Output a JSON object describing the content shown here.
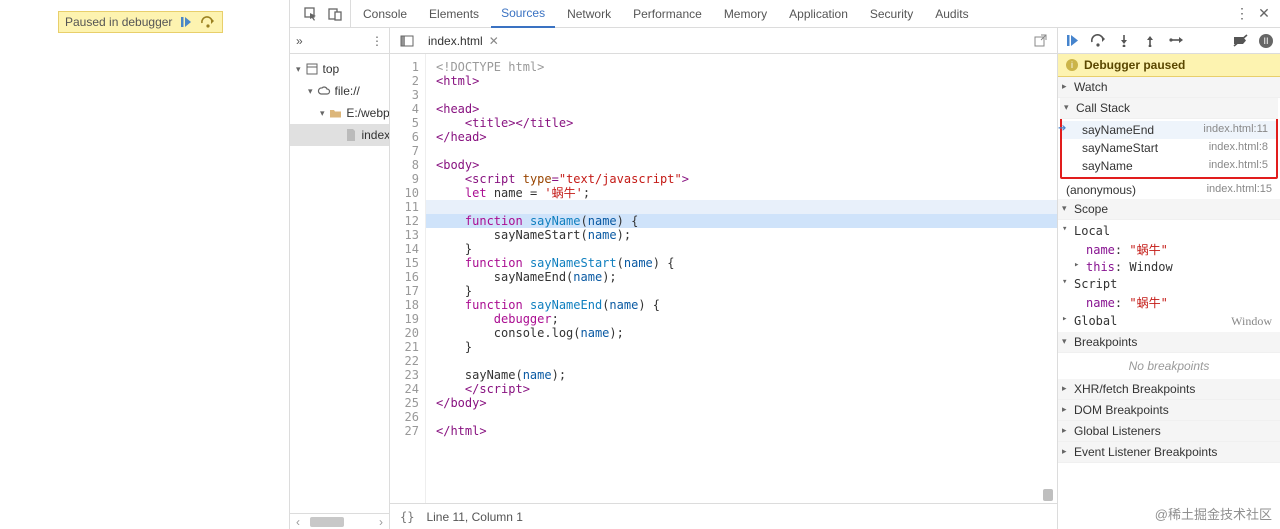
{
  "paused_overlay": {
    "label": "Paused in debugger"
  },
  "tabbar": {
    "tabs": [
      "Console",
      "Elements",
      "Sources",
      "Network",
      "Performance",
      "Memory",
      "Application",
      "Security",
      "Audits"
    ],
    "active": "Sources"
  },
  "navigator": {
    "top": "top",
    "origin": "file://",
    "folder": "E:/webp",
    "file": "index"
  },
  "editor": {
    "tab_name": "index.html",
    "status": "Line 11, Column 1",
    "lines": [
      {
        "n": 1,
        "segs": [
          {
            "t": "<!DOCTYPE html>",
            "c": "k1"
          }
        ]
      },
      {
        "n": 2,
        "segs": [
          {
            "t": "<",
            "c": "tag"
          },
          {
            "t": "html",
            "c": "tag"
          },
          {
            "t": ">",
            "c": "tag"
          }
        ]
      },
      {
        "n": 3,
        "segs": []
      },
      {
        "n": 4,
        "segs": [
          {
            "t": "<",
            "c": "tag"
          },
          {
            "t": "head",
            "c": "tag"
          },
          {
            "t": ">",
            "c": "tag"
          }
        ]
      },
      {
        "n": 5,
        "segs": [
          {
            "t": "    ",
            "c": ""
          },
          {
            "t": "<",
            "c": "tag"
          },
          {
            "t": "title",
            "c": "tag"
          },
          {
            "t": ">",
            "c": "tag"
          },
          {
            "t": "</",
            "c": "tag"
          },
          {
            "t": "title",
            "c": "tag"
          },
          {
            "t": ">",
            "c": "tag"
          }
        ]
      },
      {
        "n": 6,
        "segs": [
          {
            "t": "</",
            "c": "tag"
          },
          {
            "t": "head",
            "c": "tag"
          },
          {
            "t": ">",
            "c": "tag"
          }
        ]
      },
      {
        "n": 7,
        "segs": []
      },
      {
        "n": 8,
        "segs": [
          {
            "t": "<",
            "c": "tag"
          },
          {
            "t": "body",
            "c": "tag"
          },
          {
            "t": ">",
            "c": "tag"
          }
        ]
      },
      {
        "n": 9,
        "segs": [
          {
            "t": "    ",
            "c": ""
          },
          {
            "t": "<",
            "c": "tag"
          },
          {
            "t": "script ",
            "c": "tag"
          },
          {
            "t": "type",
            "c": "attr"
          },
          {
            "t": "=",
            "c": "tag"
          },
          {
            "t": "\"text/javascript\"",
            "c": "str"
          },
          {
            "t": ">",
            "c": "tag"
          }
        ]
      },
      {
        "n": 10,
        "segs": [
          {
            "t": "    ",
            "c": ""
          },
          {
            "t": "let",
            "c": "kw"
          },
          {
            "t": " name = ",
            "c": ""
          },
          {
            "t": "'蜗牛'",
            "c": "str"
          },
          {
            "t": ";",
            "c": ""
          }
        ]
      },
      {
        "n": 11,
        "hl": "caret",
        "segs": []
      },
      {
        "n": 12,
        "hl": "hl",
        "segs": [
          {
            "t": "    ",
            "c": ""
          },
          {
            "t": "function",
            "c": "kw"
          },
          {
            "t": " ",
            "c": ""
          },
          {
            "t": "sayName",
            "c": "id"
          },
          {
            "t": "(",
            "c": ""
          },
          {
            "t": "name",
            "c": "prm"
          },
          {
            "t": ") {",
            "c": ""
          }
        ]
      },
      {
        "n": 13,
        "segs": [
          {
            "t": "        sayNameStart(",
            "c": ""
          },
          {
            "t": "name",
            "c": "prm"
          },
          {
            "t": ");",
            "c": ""
          }
        ]
      },
      {
        "n": 14,
        "segs": [
          {
            "t": "    }",
            "c": ""
          }
        ]
      },
      {
        "n": 15,
        "segs": [
          {
            "t": "    ",
            "c": ""
          },
          {
            "t": "function",
            "c": "kw"
          },
          {
            "t": " ",
            "c": ""
          },
          {
            "t": "sayNameStart",
            "c": "id"
          },
          {
            "t": "(",
            "c": ""
          },
          {
            "t": "name",
            "c": "prm"
          },
          {
            "t": ") {",
            "c": ""
          }
        ]
      },
      {
        "n": 16,
        "segs": [
          {
            "t": "        sayNameEnd(",
            "c": ""
          },
          {
            "t": "name",
            "c": "prm"
          },
          {
            "t": ");",
            "c": ""
          }
        ]
      },
      {
        "n": 17,
        "segs": [
          {
            "t": "    }",
            "c": ""
          }
        ]
      },
      {
        "n": 18,
        "segs": [
          {
            "t": "    ",
            "c": ""
          },
          {
            "t": "function",
            "c": "kw"
          },
          {
            "t": " ",
            "c": ""
          },
          {
            "t": "sayNameEnd",
            "c": "id"
          },
          {
            "t": "(",
            "c": ""
          },
          {
            "t": "name",
            "c": "prm"
          },
          {
            "t": ") {",
            "c": ""
          }
        ]
      },
      {
        "n": 19,
        "segs": [
          {
            "t": "        ",
            "c": ""
          },
          {
            "t": "debugger",
            "c": "kw"
          },
          {
            "t": ";",
            "c": ""
          }
        ]
      },
      {
        "n": 20,
        "segs": [
          {
            "t": "        console.log(",
            "c": ""
          },
          {
            "t": "name",
            "c": "prm"
          },
          {
            "t": ");",
            "c": ""
          }
        ]
      },
      {
        "n": 21,
        "segs": [
          {
            "t": "    }",
            "c": ""
          }
        ]
      },
      {
        "n": 22,
        "segs": []
      },
      {
        "n": 23,
        "segs": [
          {
            "t": "    sayName(",
            "c": ""
          },
          {
            "t": "name",
            "c": "prm"
          },
          {
            "t": ");",
            "c": ""
          }
        ]
      },
      {
        "n": 24,
        "segs": [
          {
            "t": "    ",
            "c": ""
          },
          {
            "t": "</",
            "c": "tag"
          },
          {
            "t": "script",
            "c": "tag"
          },
          {
            "t": ">",
            "c": "tag"
          }
        ]
      },
      {
        "n": 25,
        "segs": [
          {
            "t": "</",
            "c": "tag"
          },
          {
            "t": "body",
            "c": "tag"
          },
          {
            "t": ">",
            "c": "tag"
          }
        ]
      },
      {
        "n": 26,
        "segs": []
      },
      {
        "n": 27,
        "segs": [
          {
            "t": "</",
            "c": "tag"
          },
          {
            "t": "html",
            "c": "tag"
          },
          {
            "t": ">",
            "c": "tag"
          }
        ]
      }
    ]
  },
  "debugger": {
    "paused_banner": "Debugger paused",
    "watch_label": "Watch",
    "callstack_label": "Call Stack",
    "callstack": [
      {
        "fn": "sayNameEnd",
        "loc": "index.html:11",
        "active": true
      },
      {
        "fn": "sayNameStart",
        "loc": "index.html:8"
      },
      {
        "fn": "sayName",
        "loc": "index.html:5"
      }
    ],
    "callstack_extra": {
      "fn": "(anonymous)",
      "loc": "index.html:15"
    },
    "scope_label": "Scope",
    "scopes": {
      "local_label": "Local",
      "local": [
        {
          "name": "name",
          "val": "\"蜗牛\"",
          "kind": "str"
        },
        {
          "name": "this",
          "val": "Window",
          "kind": "obj",
          "hasChild": true
        }
      ],
      "script_label": "Script",
      "script": [
        {
          "name": "name",
          "val": "\"蜗牛\"",
          "kind": "str"
        }
      ],
      "global_label": "Global",
      "global_right": "Window"
    },
    "breakpoints_label": "Breakpoints",
    "breakpoints_empty": "No breakpoints",
    "xhr_label": "XHR/fetch Breakpoints",
    "dom_label": "DOM Breakpoints",
    "gl_label": "Global Listeners",
    "el_label": "Event Listener Breakpoints"
  },
  "watermark": "@稀土掘金技术社区"
}
